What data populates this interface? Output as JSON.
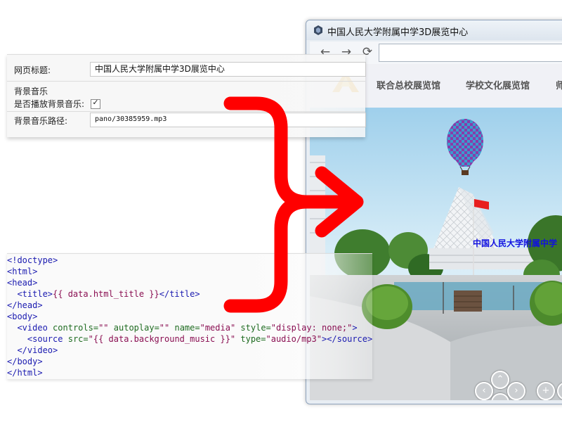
{
  "browser": {
    "window_title": "中国人民大学附属中学3D展览中心",
    "nav": {
      "back": "←",
      "forward": "→",
      "reload": "⟳"
    },
    "site": {
      "menu": [
        "联合总校展览馆",
        "学校文化展览馆",
        "师"
      ],
      "banner_text": "中国人民大学附属中学"
    },
    "controls": {
      "up": "⌃",
      "down": "⌄",
      "left": "‹",
      "right": "›",
      "zoom_in": "+"
    }
  },
  "settings": {
    "title_label": "网页标题:",
    "title_value": "中国人民大学附属中学3D展览中心",
    "section_label": "背景音乐",
    "autoplay_label": "是否播放背景音乐:",
    "autoplay_mark": "✓",
    "path_label": "背景音乐路径:",
    "path_value": "pano/30385959.mp3"
  },
  "code": {
    "l1": "<!doctype>",
    "l2": "<html>",
    "l3": "<head>",
    "l4_open": "<title>",
    "l4_expr": "{{ data.html_title }}",
    "l4_close": "</title>",
    "l5": "</head>",
    "l6": "<body>",
    "l7_tag": "<video",
    "l7_a1": "controls=",
    "l7_v1": "\"\"",
    "l7_a2": "autoplay=",
    "l7_v2": "\"\"",
    "l7_a3": "name=",
    "l7_v3": "\"media\"",
    "l7_a4": "style=",
    "l7_v4": "\"display: none;\"",
    "l7_end": ">",
    "l8_tag": "<source",
    "l8_a1": "src=",
    "l8_v1": "\"{{ data.background_music }}\"",
    "l8_a2": "type=",
    "l8_v2": "\"audio/mp3\"",
    "l8_end": "></source>",
    "l9": "</video>",
    "l10": "</body>",
    "l11": "</html>"
  },
  "colors": {
    "arrow": "#ff0000",
    "tag": "#1a1ab0",
    "attribute": "#1e6b20",
    "value": "#8a0f52",
    "banner_text": "#1010e0"
  }
}
